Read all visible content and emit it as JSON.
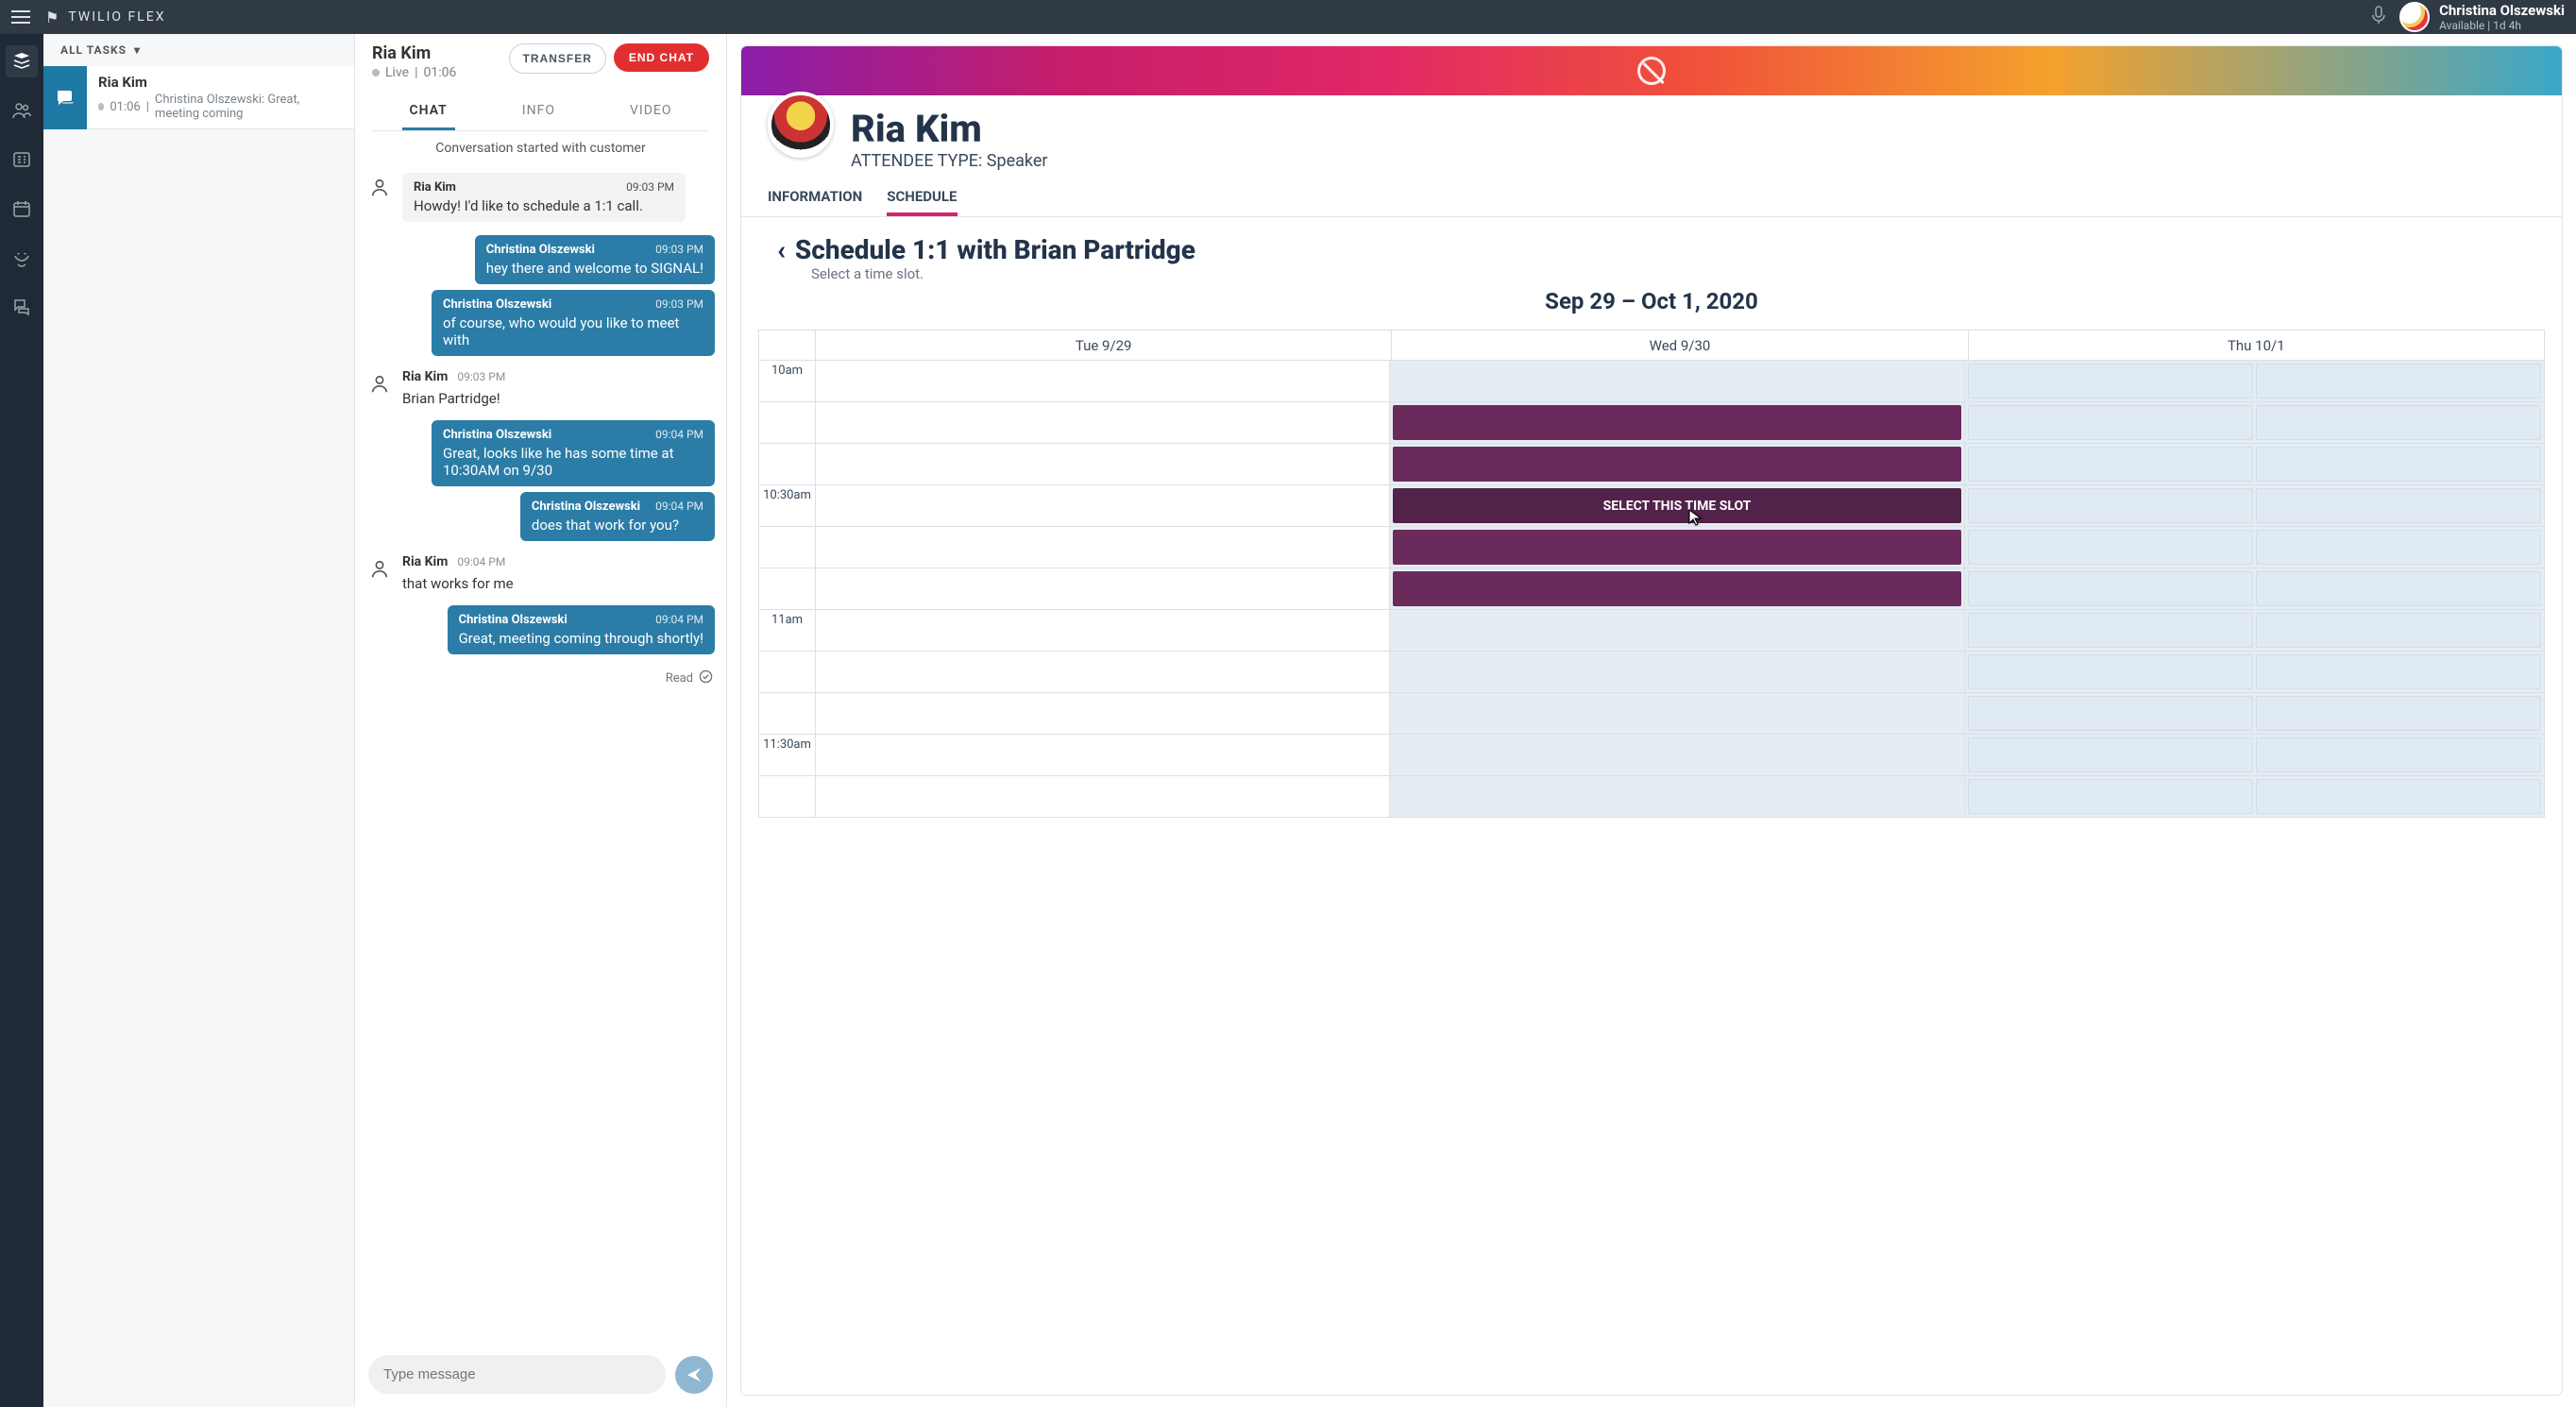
{
  "app": {
    "brand": "TWILIO FLEX"
  },
  "user": {
    "name": "Christina Olszewski",
    "status": "Available | 1d 4h"
  },
  "tasks": {
    "heading": "ALL TASKS",
    "item": {
      "title": "Ria Kim",
      "time": "01:06",
      "preview": "Christina Olszewski: Great, meeting coming"
    }
  },
  "chat": {
    "title": "Ria Kim",
    "status_label": "Live",
    "elapsed": "01:06",
    "transfer_label": "TRANSFER",
    "endchat_label": "END CHAT",
    "tabs": {
      "chat": "CHAT",
      "info": "INFO",
      "video": "VIDEO"
    },
    "conv_start": "Conversation started with customer",
    "compose_placeholder": "Type message",
    "read_label": "Read",
    "messages": [
      {
        "side": "in",
        "sender": "Ria Kim",
        "time": "09:03 PM",
        "text": "Howdy! I'd like to schedule a 1:1 call."
      },
      {
        "side": "out",
        "sender": "Christina Olszewski",
        "time": "09:03 PM",
        "text": "hey there and welcome to SIGNAL!"
      },
      {
        "side": "out",
        "sender": "Christina Olszewski",
        "time": "09:03 PM",
        "text": "of course, who would you like to meet with"
      },
      {
        "side": "in",
        "sender": "Ria Kim",
        "time": "09:03 PM",
        "text": "Brian Partridge!"
      },
      {
        "side": "out",
        "sender": "Christina Olszewski",
        "time": "09:04 PM",
        "text": "Great, looks like he has some time at 10:30AM on 9/30"
      },
      {
        "side": "out",
        "sender": "Christina Olszewski",
        "time": "09:04 PM",
        "text": "does that work for you?"
      },
      {
        "side": "in",
        "sender": "Ria Kim",
        "time": "09:04 PM",
        "text": "that works for me"
      },
      {
        "side": "out",
        "sender": "Christina Olszewski",
        "time": "09:04 PM",
        "text": "Great, meeting coming through shortly!"
      }
    ]
  },
  "crm": {
    "name": "Ria Kim",
    "attendee_line": "ATTENDEE TYPE: Speaker",
    "tabs": {
      "info": "INFORMATION",
      "schedule": "SCHEDULE"
    },
    "sched": {
      "title": "Schedule 1:1 with Brian Partridge",
      "sub": "Select a time slot.",
      "range": "Sep 29 – Oct 1, 2020",
      "days": {
        "tue": "Tue 9/29",
        "wed": "Wed 9/30",
        "thu": "Thu 10/1"
      },
      "times": {
        "t10": "10am",
        "t1030": "10:30am",
        "t11": "11am",
        "t1130": "11:30am"
      },
      "select_label": "SELECT THIS TIME SLOT"
    }
  }
}
